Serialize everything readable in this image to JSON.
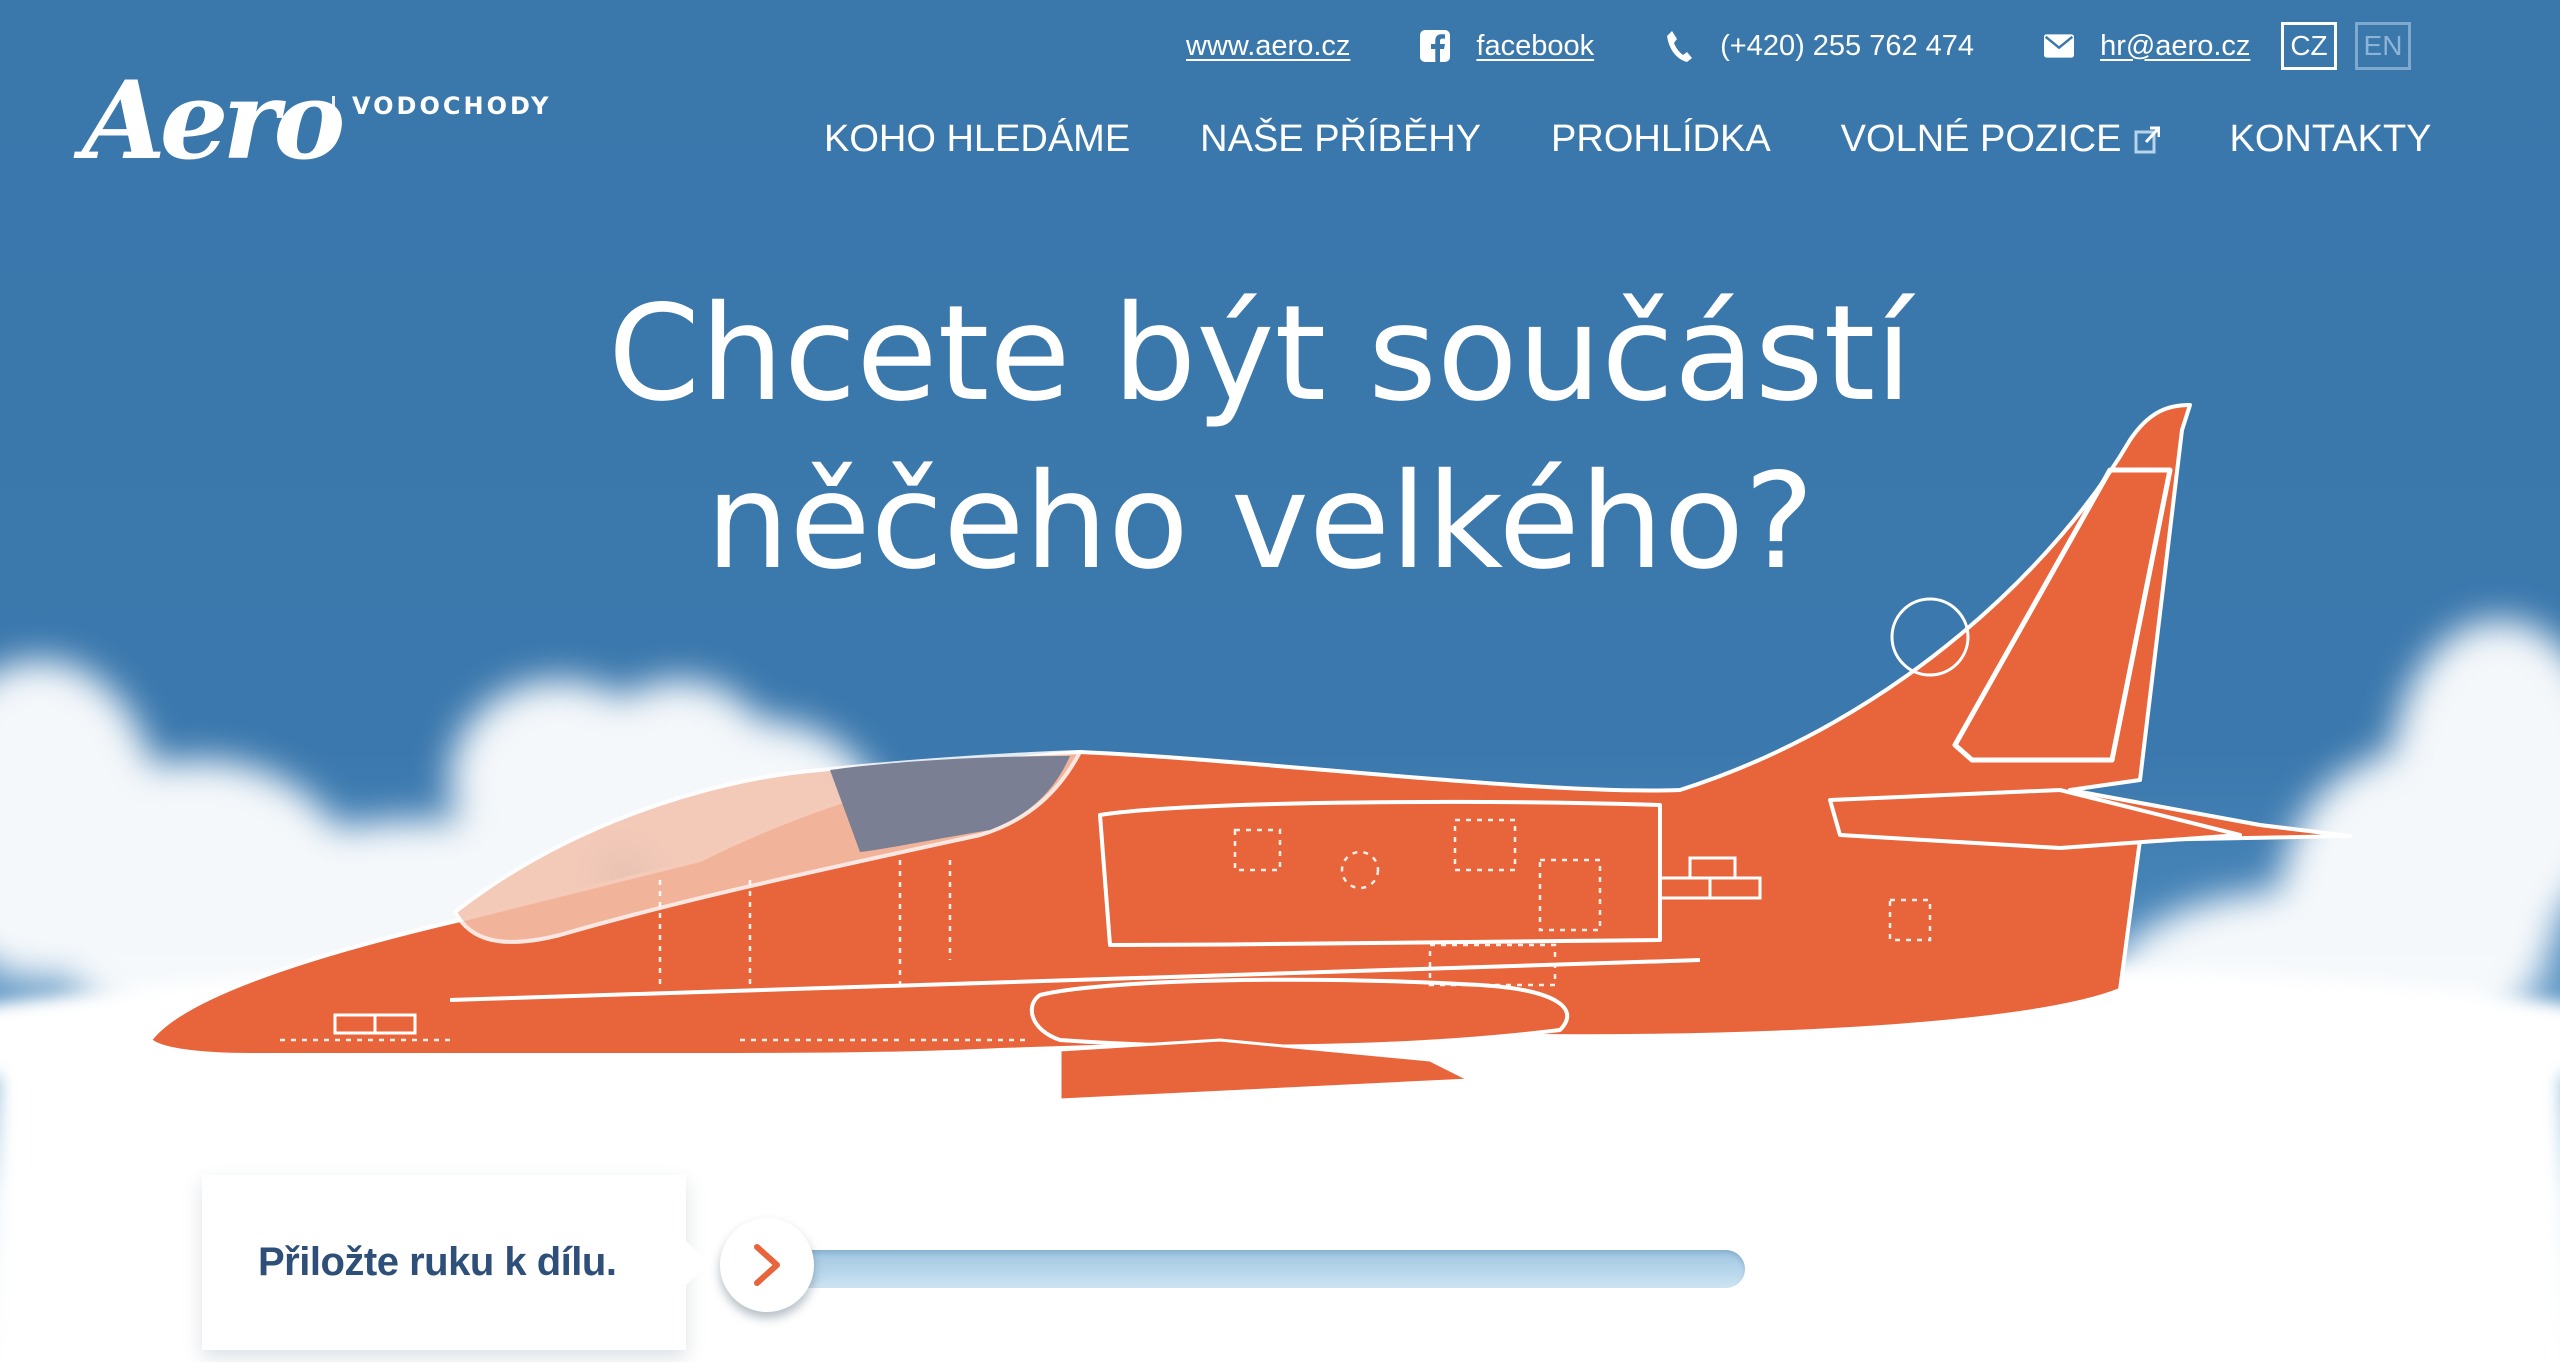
{
  "brand": {
    "logo_text": "Aero",
    "logo_subtitle": "VODOCHODY"
  },
  "topbar": {
    "website": {
      "label": "www.aero.cz"
    },
    "facebook": {
      "label": "facebook",
      "icon": "facebook-icon"
    },
    "phone": {
      "label": "(+420) 255 762 474",
      "icon": "phone-icon"
    },
    "email": {
      "label": "hr@aero.cz",
      "icon": "envelope-icon"
    },
    "languages": [
      {
        "code": "CZ",
        "active": true
      },
      {
        "code": "EN",
        "active": false
      }
    ]
  },
  "nav": {
    "items": [
      {
        "label": "KOHO HLEDÁME"
      },
      {
        "label": "NAŠE PŘÍBĚHY"
      },
      {
        "label": "PROHLÍDKA"
      },
      {
        "label": "VOLNÉ POZICE",
        "icon": "external-link-icon"
      },
      {
        "label": "KONTAKTY"
      }
    ]
  },
  "hero": {
    "title_line1": "Chcete být součástí",
    "title_line2": "něčeho velkého?"
  },
  "cta": {
    "label": "Přiložte ruku k dílu.",
    "slider_icon": "chevron-right-icon"
  },
  "colors": {
    "sky": "#3a77ab",
    "plane": "#e8643a",
    "cta_text": "#2d4f78",
    "accent": "#e8643a",
    "track": "#b9d7ec"
  }
}
